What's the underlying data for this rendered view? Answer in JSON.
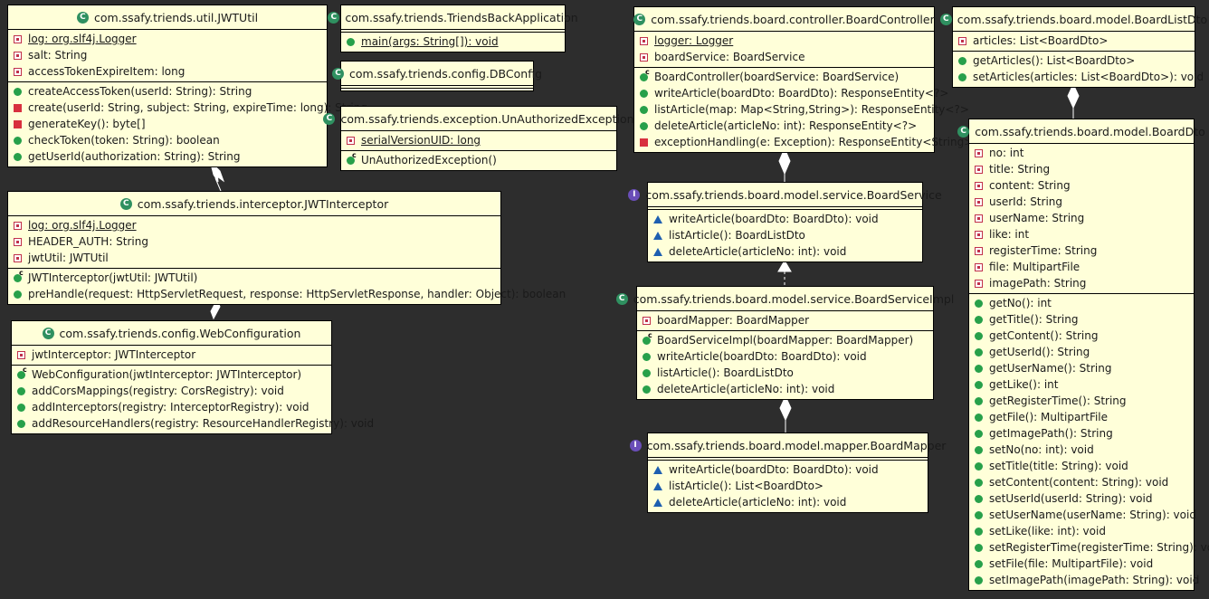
{
  "classes": {
    "jwtutil": {
      "name": "com.ssafy.triends.util.JWTUtil",
      "fields": [
        {
          "text": "log: org.slf4j.Logger",
          "icon": "fpriv",
          "static": true
        },
        {
          "text": "salt: String",
          "icon": "fpriv"
        },
        {
          "text": "accessTokenExpireItem: long",
          "icon": "fpriv"
        }
      ],
      "methods": [
        {
          "text": "createAccessToken(userId: String): String",
          "icon": "mpub"
        },
        {
          "text": "create(userId: String, subject: String, expireTime: long): String",
          "icon": "mpriv"
        },
        {
          "text": "generateKey(): byte[]",
          "icon": "mpriv"
        },
        {
          "text": "checkToken(token: String): boolean",
          "icon": "mpub"
        },
        {
          "text": "getUserId(authorization: String): String",
          "icon": "mpub"
        }
      ]
    },
    "app": {
      "name": "com.ssafy.triends.TriendsBackApplication",
      "fields": [],
      "methods": [
        {
          "text": "main(args: String[]): void",
          "icon": "mpub",
          "static": true
        }
      ]
    },
    "dbconfig": {
      "name": "com.ssafy.triends.config.DBConfig",
      "fields": [],
      "methods": []
    },
    "unauth": {
      "name": "com.ssafy.triends.exception.UnAuthorizedException",
      "fields": [
        {
          "text": "serialVersionUID: long",
          "icon": "fpriv",
          "static": true
        }
      ],
      "methods": [
        {
          "text": "UnAuthorizedException()",
          "icon": "mpub",
          "ctor": true
        }
      ]
    },
    "controller": {
      "name": "com.ssafy.triends.board.controller.BoardController",
      "fields": [
        {
          "text": "logger: Logger",
          "icon": "fpriv",
          "static": true
        },
        {
          "text": "boardService: BoardService",
          "icon": "fpriv"
        }
      ],
      "methods": [
        {
          "text": "BoardController(boardService: BoardService)",
          "icon": "mpub",
          "ctor": true
        },
        {
          "text": "writeArticle(boardDto: BoardDto): ResponseEntity<?>",
          "icon": "mpub"
        },
        {
          "text": "listArticle(map: Map<String,String>): ResponseEntity<?>",
          "icon": "mpub"
        },
        {
          "text": "deleteArticle(articleNo: int): ResponseEntity<?>",
          "icon": "mpub"
        },
        {
          "text": "exceptionHandling(e: Exception): ResponseEntity<String>",
          "icon": "mpriv"
        }
      ]
    },
    "boardlistdto": {
      "name": "com.ssafy.triends.board.model.BoardListDto",
      "fields": [
        {
          "text": "articles: List<BoardDto>",
          "icon": "fpriv"
        }
      ],
      "methods": [
        {
          "text": "getArticles(): List<BoardDto>",
          "icon": "mpub"
        },
        {
          "text": "setArticles(articles: List<BoardDto>): void",
          "icon": "mpub"
        }
      ]
    },
    "interceptor": {
      "name": "com.ssafy.triends.interceptor.JWTInterceptor",
      "fields": [
        {
          "text": "log: org.slf4j.Logger",
          "icon": "fpriv",
          "static": true
        },
        {
          "text": "HEADER_AUTH: String",
          "icon": "fpriv"
        },
        {
          "text": "jwtUtil: JWTUtil",
          "icon": "fpriv"
        }
      ],
      "methods": [
        {
          "text": "JWTInterceptor(jwtUtil: JWTUtil)",
          "icon": "mpub",
          "ctor": true
        },
        {
          "text": "preHandle(request: HttpServletRequest, response: HttpServletResponse, handler: Object): boolean",
          "icon": "mpub"
        }
      ]
    },
    "boardservice": {
      "name": "com.ssafy.triends.board.model.service.BoardService",
      "interface": true,
      "fields": [],
      "methods": [
        {
          "text": "writeArticle(boardDto: BoardDto): void",
          "icon": "mpkg"
        },
        {
          "text": "listArticle(): BoardListDto",
          "icon": "mpkg"
        },
        {
          "text": "deleteArticle(articleNo: int): void",
          "icon": "mpkg"
        }
      ]
    },
    "webconfig": {
      "name": "com.ssafy.triends.config.WebConfiguration",
      "fields": [
        {
          "text": "jwtInterceptor: JWTInterceptor",
          "icon": "fpriv"
        }
      ],
      "methods": [
        {
          "text": "WebConfiguration(jwtInterceptor: JWTInterceptor)",
          "icon": "mpub",
          "ctor": true
        },
        {
          "text": "addCorsMappings(registry: CorsRegistry): void",
          "icon": "mpub"
        },
        {
          "text": "addInterceptors(registry: InterceptorRegistry): void",
          "icon": "mpub"
        },
        {
          "text": "addResourceHandlers(registry: ResourceHandlerRegistry): void",
          "icon": "mpub"
        }
      ]
    },
    "serviceimpl": {
      "name": "com.ssafy.triends.board.model.service.BoardServiceImpl",
      "fields": [
        {
          "text": "boardMapper: BoardMapper",
          "icon": "fpriv"
        }
      ],
      "methods": [
        {
          "text": "BoardServiceImpl(boardMapper: BoardMapper)",
          "icon": "mpub",
          "ctor": true
        },
        {
          "text": "writeArticle(boardDto: BoardDto): void",
          "icon": "mpub"
        },
        {
          "text": "listArticle(): BoardListDto",
          "icon": "mpub"
        },
        {
          "text": "deleteArticle(articleNo: int): void",
          "icon": "mpub"
        }
      ]
    },
    "mapper": {
      "name": "com.ssafy.triends.board.model.mapper.BoardMapper",
      "interface": true,
      "fields": [],
      "methods": [
        {
          "text": "writeArticle(boardDto: BoardDto): void",
          "icon": "mpkg"
        },
        {
          "text": "listArticle(): List<BoardDto>",
          "icon": "mpkg"
        },
        {
          "text": "deleteArticle(articleNo: int): void",
          "icon": "mpkg"
        }
      ]
    },
    "boarddto": {
      "name": "com.ssafy.triends.board.model.BoardDto",
      "fields": [
        {
          "text": "no: int",
          "icon": "fpriv"
        },
        {
          "text": "title: String",
          "icon": "fpriv"
        },
        {
          "text": "content: String",
          "icon": "fpriv"
        },
        {
          "text": "userId: String",
          "icon": "fpriv"
        },
        {
          "text": "userName: String",
          "icon": "fpriv"
        },
        {
          "text": "like: int",
          "icon": "fpriv"
        },
        {
          "text": "registerTime: String",
          "icon": "fpriv"
        },
        {
          "text": "file: MultipartFile",
          "icon": "fpriv"
        },
        {
          "text": "imagePath: String",
          "icon": "fpriv"
        }
      ],
      "methods": [
        {
          "text": "getNo(): int",
          "icon": "mpub"
        },
        {
          "text": "getTitle(): String",
          "icon": "mpub"
        },
        {
          "text": "getContent(): String",
          "icon": "mpub"
        },
        {
          "text": "getUserId(): String",
          "icon": "mpub"
        },
        {
          "text": "getUserName(): String",
          "icon": "mpub"
        },
        {
          "text": "getLike(): int",
          "icon": "mpub"
        },
        {
          "text": "getRegisterTime(): String",
          "icon": "mpub"
        },
        {
          "text": "getFile(): MultipartFile",
          "icon": "mpub"
        },
        {
          "text": "getImagePath(): String",
          "icon": "mpub"
        },
        {
          "text": "setNo(no: int): void",
          "icon": "mpub"
        },
        {
          "text": "setTitle(title: String): void",
          "icon": "mpub"
        },
        {
          "text": "setContent(content: String): void",
          "icon": "mpub"
        },
        {
          "text": "setUserId(userId: String): void",
          "icon": "mpub"
        },
        {
          "text": "setUserName(userName: String): void",
          "icon": "mpub"
        },
        {
          "text": "setLike(like: int): void",
          "icon": "mpub"
        },
        {
          "text": "setRegisterTime(registerTime: String): void",
          "icon": "mpub"
        },
        {
          "text": "setFile(file: MultipartFile): void",
          "icon": "mpub"
        },
        {
          "text": "setImagePath(imagePath: String): void",
          "icon": "mpub"
        }
      ]
    }
  },
  "relations": [
    {
      "from": "interceptor",
      "to": "jwtutil",
      "kind": "aggregation"
    },
    {
      "from": "webconfig",
      "to": "interceptor",
      "kind": "aggregation"
    },
    {
      "from": "controller",
      "to": "boardservice",
      "kind": "aggregation"
    },
    {
      "from": "serviceimpl",
      "to": "boardservice",
      "kind": "realization"
    },
    {
      "from": "serviceimpl",
      "to": "mapper",
      "kind": "aggregation"
    },
    {
      "from": "boardlistdto",
      "to": "boarddto",
      "kind": "aggregation"
    }
  ],
  "colors": {
    "background": "#2d2d2d",
    "box": "#ffffd9",
    "border": "#000000"
  }
}
